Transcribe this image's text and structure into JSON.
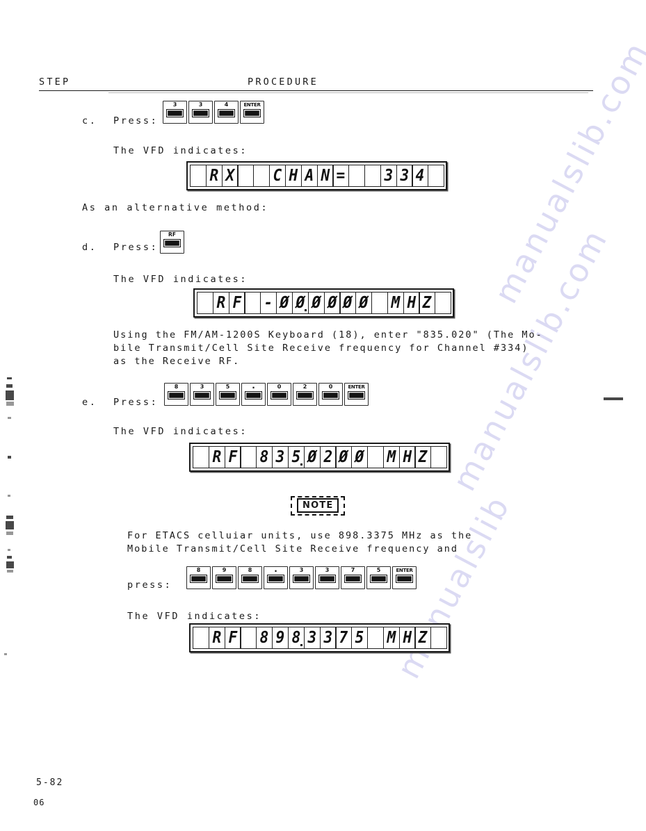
{
  "header": {
    "step_label": "STEP",
    "procedure_label": "PROCEDURE"
  },
  "steps": [
    {
      "id": "c",
      "marker": "c.",
      "press_label": "Press:",
      "keys": [
        "3",
        "3",
        "4",
        "ENTER"
      ],
      "vfd_caption": "The VFD indicates:",
      "vfd_cells": [
        "",
        "R",
        "X",
        "",
        "",
        "C",
        "H",
        "A",
        "N",
        "=",
        "",
        "",
        "3",
        "3",
        "4",
        ""
      ]
    },
    {
      "id": "d",
      "marker": "d.",
      "press_label": "Press:",
      "keys": [
        "RF"
      ],
      "vfd_caption": "The VFD indicates:",
      "vfd_cells": [
        "",
        "R",
        "F",
        "",
        "-",
        "0",
        "0",
        "0",
        "0",
        "0",
        "0",
        "",
        "M",
        "H",
        "Z",
        ""
      ]
    },
    {
      "id": "e",
      "marker": "e.",
      "press_label": "Press:",
      "keys": [
        "8",
        "3",
        "5",
        ".",
        "0",
        "2",
        "0",
        "ENTER"
      ],
      "vfd_caption": "The VFD indicates:",
      "vfd_cells": [
        "",
        "R",
        "F",
        "",
        "8",
        "3",
        "5",
        "0",
        "2",
        "0",
        "0",
        "",
        "M",
        "H",
        "Z",
        ""
      ]
    }
  ],
  "alternative_method_text": "As an alternative method:",
  "instruction_paragraph": [
    "Using the FM/AM-1200S Keyboard (18), enter \"835.020\" (The Mo-",
    "bile Transmit/Cell Site Receive frequency for Channel #334)",
    "as the Receive RF."
  ],
  "note": {
    "title": "NOTE",
    "body": [
      "For ETACS celluiar units, use 898.3375 MHz as the",
      "Mobile Transmit/Cell Site Receive frequency and"
    ],
    "press_label": "press:",
    "keys": [
      "8",
      "9",
      "8",
      ".",
      "3",
      "3",
      "7",
      "5",
      "ENTER"
    ],
    "vfd_caption": "The VFD indicates:",
    "vfd_cells": [
      "",
      "R",
      "F",
      "",
      "8",
      "9",
      "8",
      "3",
      "3",
      "7",
      "5",
      "",
      "M",
      "H",
      "Z",
      ""
    ]
  },
  "footer": {
    "page_number": "5-82",
    "revision": "06"
  },
  "watermark": {
    "line1": "manualslib.com",
    "line2": "manualslib.com",
    "line3": "manualslib"
  }
}
